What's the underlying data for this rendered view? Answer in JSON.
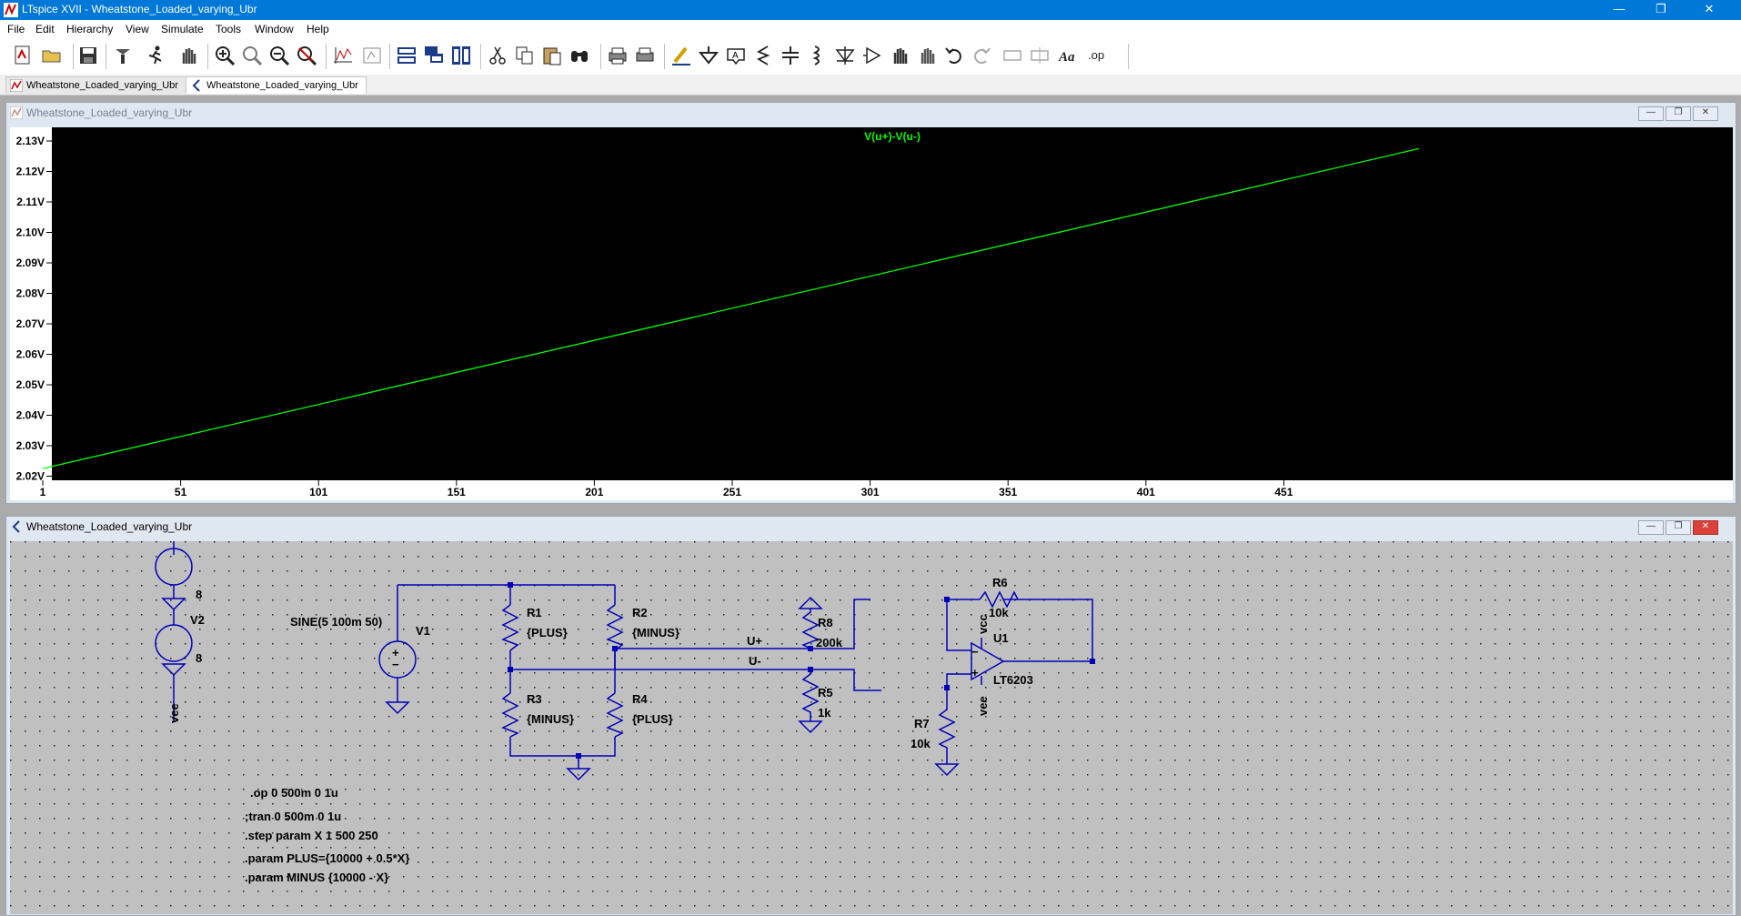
{
  "window": {
    "title": "LTspice XVII - Wheatstone_Loaded_varying_Ubr",
    "min_label": "—",
    "max_label": "❐",
    "close_label": "✕"
  },
  "menu": [
    "File",
    "Edit",
    "Hierarchy",
    "View",
    "Simulate",
    "Tools",
    "Window",
    "Help"
  ],
  "toolbar": {
    "icons": [
      "new-schematic-icon",
      "open-icon",
      "save-icon",
      "control-panel-icon",
      "run-icon",
      "halt-icon",
      "zoom-in-icon",
      "zoom-pan-icon",
      "zoom-out-icon",
      "zoom-cancel-icon",
      "autorange-icon",
      "fit-icon",
      "tile-horizontal-icon",
      "cascade-icon",
      "tile-vertical-icon",
      "cut-icon",
      "copy-icon",
      "paste-icon",
      "find-icon",
      "print-icon",
      "print-setup-icon",
      "draw-wire-icon",
      "ground-icon",
      "label-net-icon",
      "resistor-icon",
      "capacitor-icon",
      "inductor-icon",
      "diode-icon",
      "component-icon",
      "move-icon",
      "drag-icon",
      "undo-icon",
      "redo-icon",
      "rotate-icon",
      "mirror-icon",
      "text-icon",
      "spice-directive-icon"
    ],
    "text_icon_label": "Aa",
    "op_label": ".op"
  },
  "tabs": [
    {
      "label": "Wheatstone_Loaded_varying_Ubr",
      "kind": "waveform",
      "active": false
    },
    {
      "label": "Wheatstone_Loaded_varying_Ubr",
      "kind": "schematic",
      "active": true
    }
  ],
  "plot_window": {
    "caption": "Wheatstone_Loaded_varying_Ubr",
    "trace_label": "V(u+)-V(u-)",
    "trace_color": "#00ff00"
  },
  "chart_data": {
    "type": "line",
    "title": "V(u+)-V(u-)",
    "xlabel": "",
    "ylabel": "",
    "x_ticks": [
      "1",
      "51",
      "101",
      "151",
      "201",
      "251",
      "301",
      "351",
      "401",
      "451"
    ],
    "y_ticks": [
      "2.02V",
      "2.03V",
      "2.04V",
      "2.05V",
      "2.06V",
      "2.07V",
      "2.08V",
      "2.09V",
      "2.10V",
      "2.11V",
      "2.12V",
      "2.13V"
    ],
    "xlim": [
      1,
      500
    ],
    "ylim": [
      2.02,
      2.13
    ],
    "series": [
      {
        "name": "V(u+)-V(u-)",
        "color": "#00ff00",
        "x": [
          1,
          500
        ],
        "y": [
          2.0225,
          2.1275
        ]
      }
    ],
    "background": "#000000",
    "grid": false
  },
  "schematic_window": {
    "caption": "Wheatstone_Loaded_varying_Ubr",
    "wire_color": "#0000b8",
    "components": {
      "v2_top_value": "8",
      "v2_name": "V2",
      "v2_bottom_value": "8",
      "vee_label": "vee",
      "v1_value": "SINE(5 100m 50)",
      "v1_name": "V1",
      "r1_name": "R1",
      "r1_value": "{PLUS}",
      "r2_name": "R2",
      "r2_value": "{MINUS}",
      "r3_name": "R3",
      "r3_value": "{MINUS}",
      "r4_name": "R4",
      "r4_value": "{PLUS}",
      "uplus_label": "U+",
      "uminus_label": "U-",
      "r8_name": "R8",
      "r8_value": "200k",
      "r5_name": "R5",
      "r5_value": "1k",
      "r6_name": "R6",
      "r6_value": "10k",
      "u1_name": "U1",
      "u1_value": "LT6203",
      "vcc_label": "vcc",
      "vee2_label": "vee",
      "r7_name": "R7",
      "r7_value": "10k",
      "plus_sign": "+",
      "minus_sign": "−"
    },
    "directives": [
      ".op 0 500m 0 1u",
      ";tran 0 500m 0 1u",
      ".step param X 1 500 250",
      ".param PLUS={10000 + 0.5*X}",
      ".param MINUS {10000 - X}"
    ]
  }
}
